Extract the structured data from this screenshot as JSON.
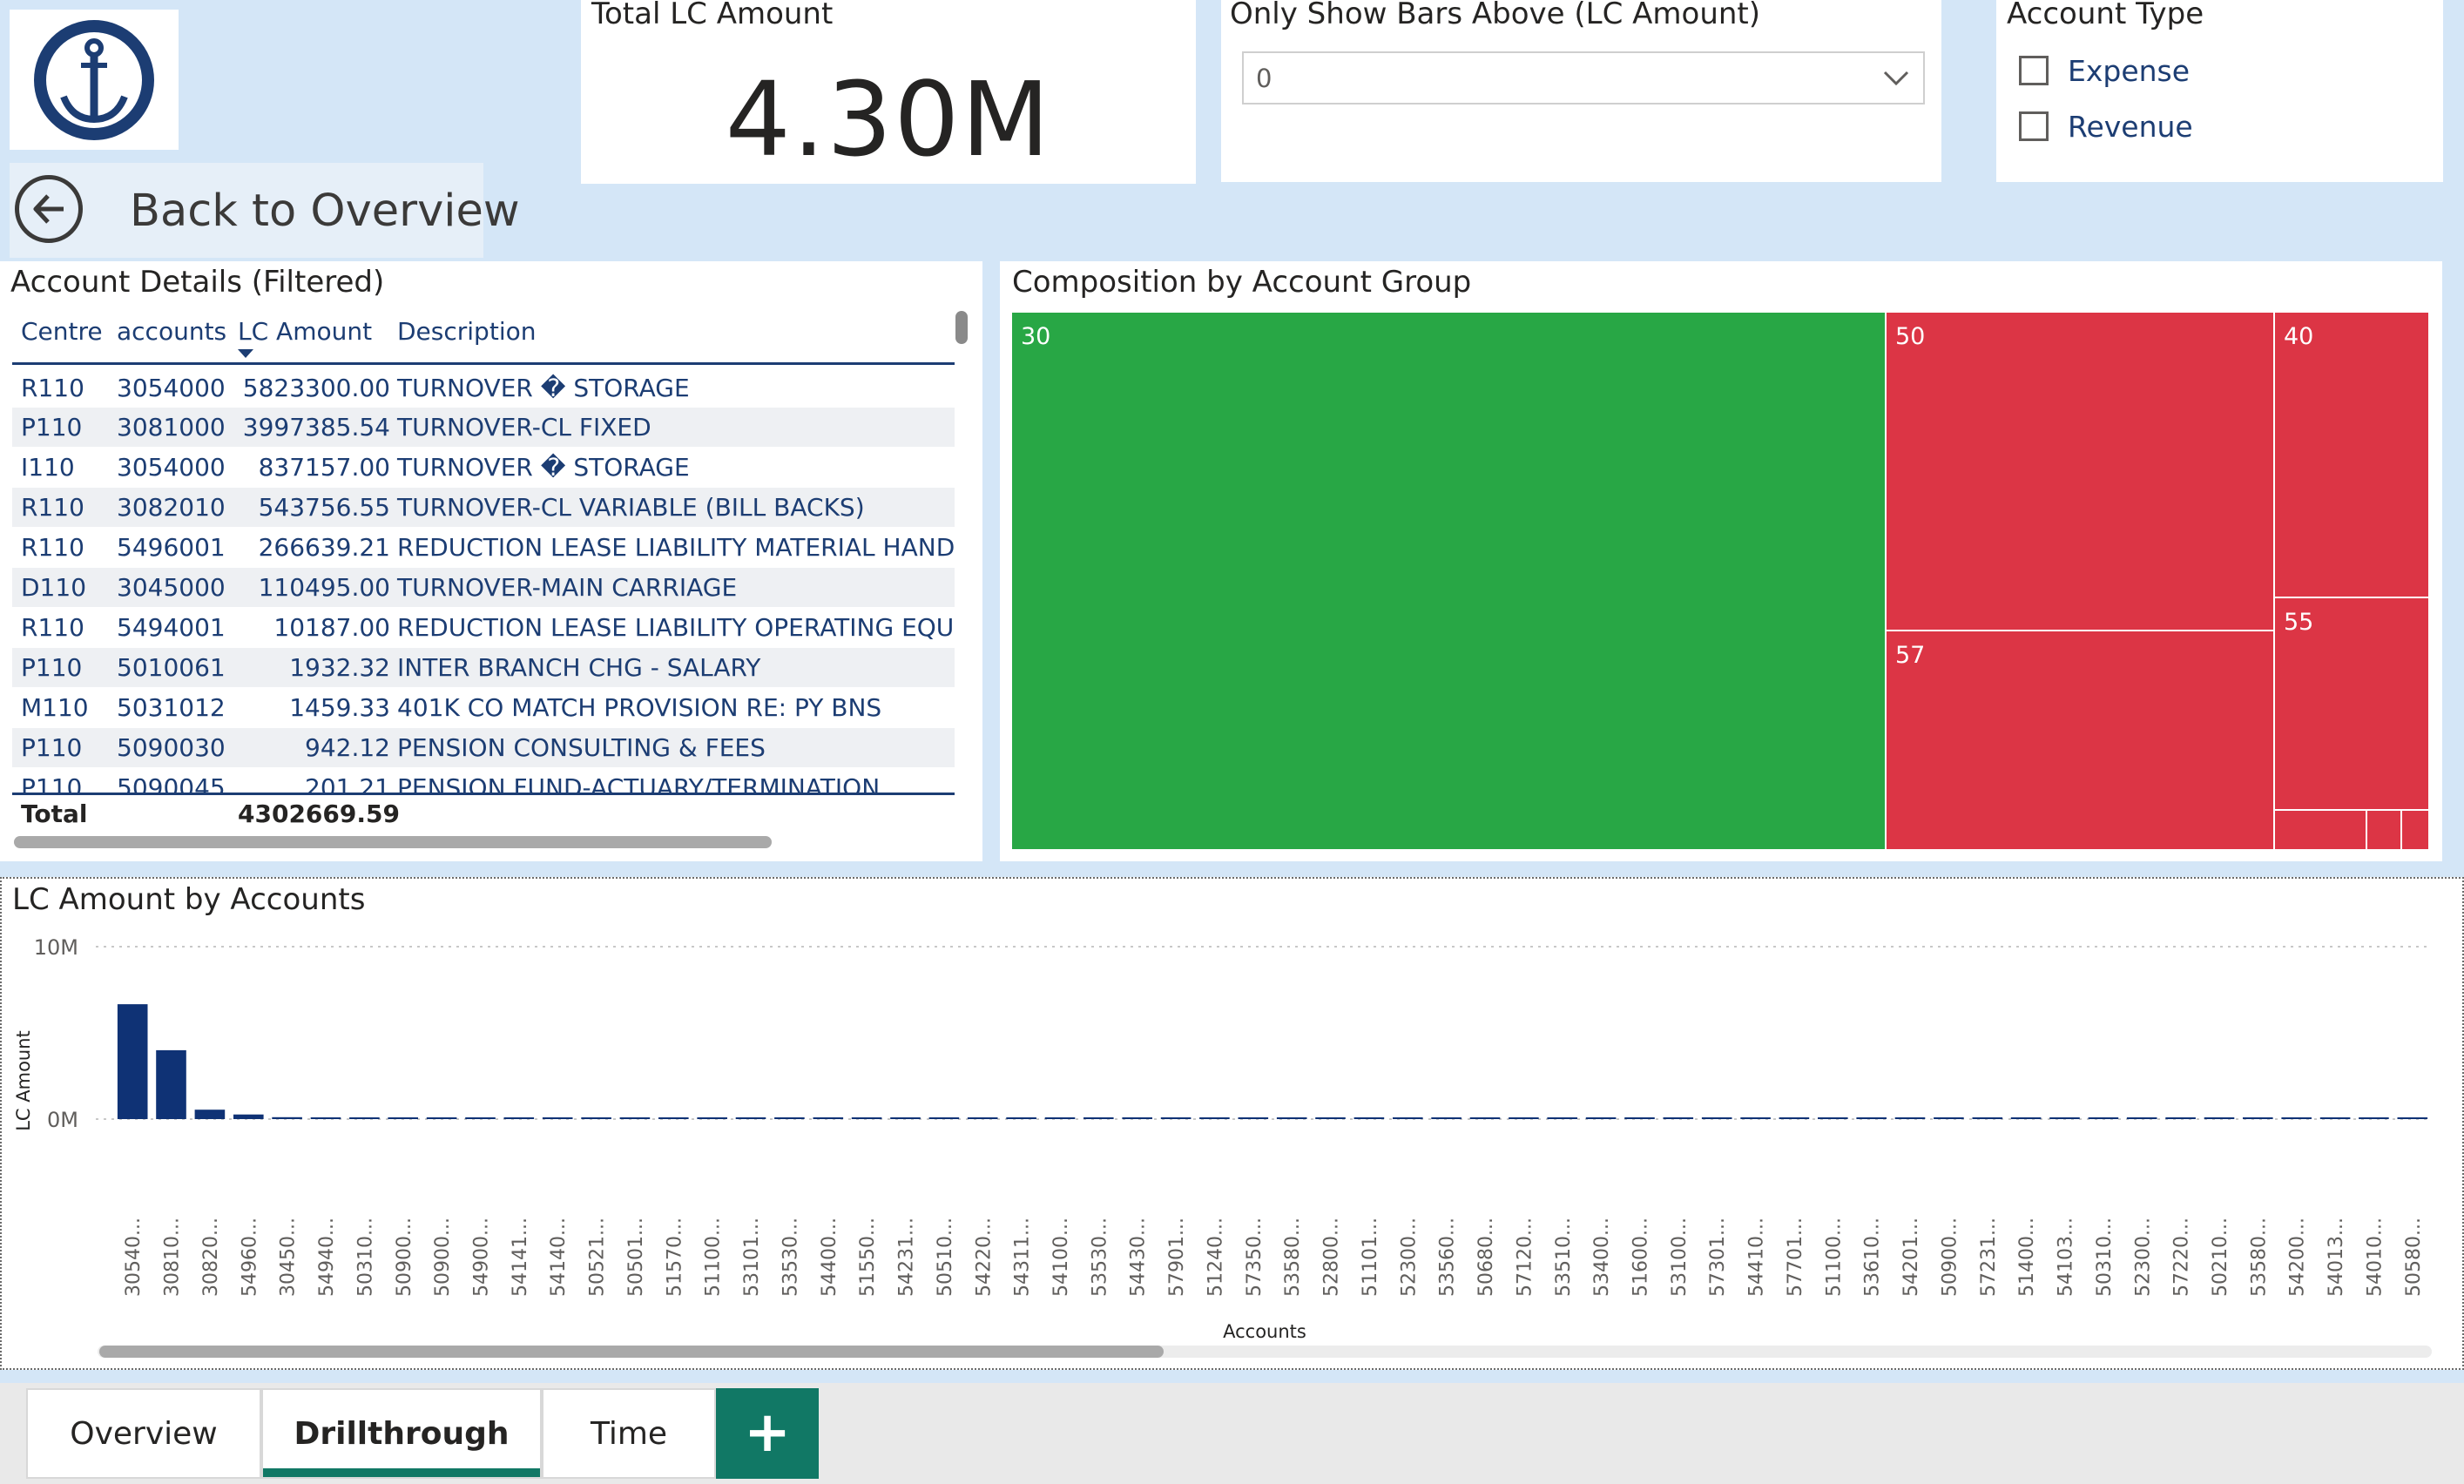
{
  "colors": {
    "canvas_bg": "#d4e6f7",
    "header_text": "#1c3d73",
    "bar": "#0f3275",
    "treemap_green": "#28a745",
    "treemap_red": "#dc3545",
    "tab_accent": "#117865"
  },
  "logo": {
    "icon": "anchor-icon"
  },
  "nav": {
    "back_label": "Back to Overview",
    "back_icon": "arrow-left-circle-icon"
  },
  "kpi": {
    "title": "Total LC Amount",
    "value": "4.30M"
  },
  "slicer": {
    "title": "Only Show Bars Above (LC Amount)",
    "value": "0",
    "icon": "chevron-down-icon"
  },
  "account_type": {
    "title": "Account Type",
    "options": [
      {
        "label": "Expense",
        "checked": false
      },
      {
        "label": "Revenue",
        "checked": false
      }
    ]
  },
  "table": {
    "title": "Account Details (Filtered)",
    "columns": [
      "Centre",
      "accounts",
      "LC Amount",
      "Description"
    ],
    "sort_icon": "sort-descending-icon",
    "rows": [
      [
        "R110",
        "3054000",
        "5823300.00",
        "TURNOVER � STORAGE"
      ],
      [
        "P110",
        "3081000",
        "3997385.54",
        "TURNOVER-CL FIXED"
      ],
      [
        "I110",
        "3054000",
        "837157.00",
        "TURNOVER � STORAGE"
      ],
      [
        "R110",
        "3082010",
        "543756.55",
        "TURNOVER-CL VARIABLE (BILL BACKS)"
      ],
      [
        "R110",
        "5496001",
        "266639.21",
        "REDUCTION LEASE LIABILITY MATERIAL HANDLIN"
      ],
      [
        "D110",
        "3045000",
        "110495.00",
        "TURNOVER-MAIN CARRIAGE"
      ],
      [
        "R110",
        "5494001",
        "10187.00",
        "REDUCTION LEASE LIABILITY OPERATING EQUIPM"
      ],
      [
        "P110",
        "5010061",
        "1932.32",
        "INTER BRANCH CHG - SALARY"
      ],
      [
        "M110",
        "5031012",
        "1459.33",
        "401K CO MATCH PROVISION RE: PY BNS"
      ],
      [
        "P110",
        "5090030",
        "942.12",
        "PENSION CONSULTING & FEES"
      ],
      [
        "P110",
        "5090045",
        "201.21",
        "PENSION FUND-ACTUARY/TERMINATION"
      ]
    ],
    "total_label": "Total",
    "total_value": "4302669.59"
  },
  "treemap": {
    "title": "Composition by Account Group",
    "cells": [
      {
        "label": "30",
        "color": "#28a745"
      },
      {
        "label": "50",
        "color": "#dc3545"
      },
      {
        "label": "40",
        "color": "#dc3545"
      },
      {
        "label": "57",
        "color": "#dc3545"
      },
      {
        "label": "55",
        "color": "#dc3545"
      },
      {
        "label": "",
        "color": "#dc3545"
      },
      {
        "label": "",
        "color": "#dc3545"
      },
      {
        "label": "",
        "color": "#dc3545"
      }
    ]
  },
  "chart_data": {
    "type": "bar",
    "title": "LC Amount by Accounts",
    "xlabel": "Accounts",
    "ylabel": "LC Amount",
    "y_tick_labels": [
      "10M",
      "0M"
    ],
    "ylim": [
      0,
      10000000
    ],
    "grid": true,
    "categories": [
      "30540...",
      "30810...",
      "30820...",
      "54960...",
      "30450...",
      "54940...",
      "50310...",
      "50900...",
      "50900...",
      "54900...",
      "54141...",
      "54140...",
      "50521...",
      "50501...",
      "51570...",
      "51100...",
      "53101...",
      "53530...",
      "54400...",
      "51550...",
      "54231...",
      "50510...",
      "54220...",
      "54311...",
      "54100...",
      "53530...",
      "54430...",
      "57901...",
      "51240...",
      "57350...",
      "53580...",
      "52800...",
      "51101...",
      "52300...",
      "53560...",
      "50680...",
      "57120...",
      "53510...",
      "53400...",
      "51600...",
      "53100...",
      "57301...",
      "54410...",
      "57701...",
      "51100...",
      "53610...",
      "54201...",
      "50900...",
      "57231...",
      "51400...",
      "54103...",
      "50310...",
      "52300...",
      "57220...",
      "50210...",
      "53580...",
      "54200...",
      "54013...",
      "54010...",
      "50580..."
    ],
    "values": [
      6660000,
      3997386,
      543757,
      266639,
      110495,
      10187,
      8000,
      7000,
      6000,
      5500,
      5000,
      4500,
      4000,
      3500,
      3000,
      2800,
      2600,
      2400,
      2200,
      2000,
      1932,
      1800,
      1700,
      1600,
      1459,
      1400,
      1300,
      1200,
      1100,
      1000,
      942,
      900,
      850,
      800,
      750,
      700,
      650,
      600,
      550,
      500,
      450,
      400,
      350,
      300,
      280,
      260,
      240,
      220,
      201,
      190,
      180,
      170,
      160,
      150,
      140,
      130,
      120,
      110,
      100,
      90
    ]
  },
  "tabs": {
    "items": [
      {
        "label": "Overview",
        "active": false
      },
      {
        "label": "Drillthrough",
        "active": true
      },
      {
        "label": "Time",
        "active": false
      }
    ],
    "add_label": "+"
  }
}
